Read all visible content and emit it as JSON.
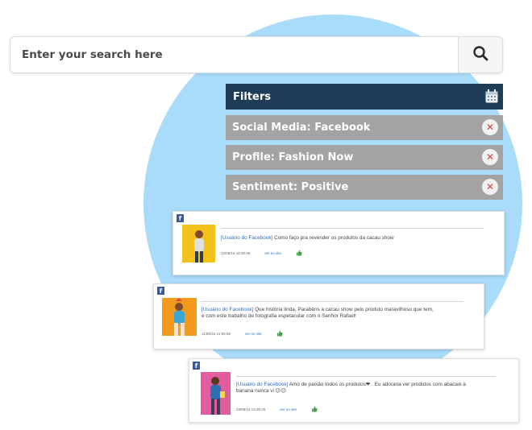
{
  "search": {
    "placeholder": "Enter your search here",
    "button_icon": "search-icon"
  },
  "filters": {
    "title": "Filters",
    "header_icon": "calendar-icon",
    "chips": [
      {
        "label": "Social Media: Facebook",
        "remove_icon": "close-icon"
      },
      {
        "label": "Profile: Fashion Now",
        "remove_icon": "close-icon"
      },
      {
        "label": "Sentiment: Positive",
        "remove_icon": "close-icon"
      }
    ]
  },
  "posts": [
    {
      "network_icon": "facebook-icon",
      "user": "[Usuário do Facebook]",
      "text": " Como faço pra revender os produtos da cacau show",
      "timestamp": "12/09/16 16:20:06",
      "reply_label": "ver no site",
      "thumb_bg": "#f3c21a"
    },
    {
      "network_icon": "facebook-icon",
      "user": "[Usuário do Facebook]",
      "text": " Que história linda, Parabéns a cacau show pelo produto maravilhoso que tem, e com este trabalho de fotografia espetacular com o Senhor Rafael!",
      "timestamp": "11/08/16 21:06:56",
      "reply_label": "ver no site",
      "thumb_bg": "#f39a1d"
    },
    {
      "network_icon": "facebook-icon",
      "user": "[Usuário do Facebook]",
      "text": " Amo de paixão todos os produtos❤ . Eu adoraria ver produtos com abacaxi à banana nunca vi 😕😕",
      "timestamp": "23/08/16 13:36:28",
      "reply_label": "ver no site",
      "thumb_bg": "#e25d9e"
    }
  ],
  "colors": {
    "circle": "#a9dcfa",
    "filters_header": "#203d57",
    "chip": "#a3a3a3",
    "remove": "#d6413c",
    "facebook": "#3b5998",
    "link": "#2c6fc1",
    "like": "#43a047"
  }
}
